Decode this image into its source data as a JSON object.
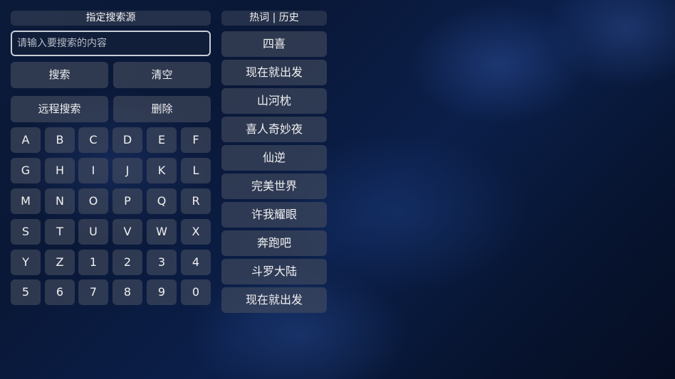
{
  "source_title": "指定搜索源",
  "history_title": "热词 | 历史",
  "search": {
    "placeholder": "请输入要搜索的内容",
    "value": ""
  },
  "buttons": {
    "search": "搜索",
    "clear": "清空",
    "remote_search": "远程搜索",
    "delete": "删除"
  },
  "keyboard": [
    [
      "A",
      "B",
      "C",
      "D",
      "E",
      "F"
    ],
    [
      "G",
      "H",
      "I",
      "J",
      "K",
      "L"
    ],
    [
      "M",
      "N",
      "O",
      "P",
      "Q",
      "R"
    ],
    [
      "S",
      "T",
      "U",
      "V",
      "W",
      "X"
    ],
    [
      "Y",
      "Z",
      "1",
      "2",
      "3",
      "4"
    ],
    [
      "5",
      "6",
      "7",
      "8",
      "9",
      "0"
    ]
  ],
  "hot_words": [
    "四喜",
    "现在就出发",
    "山河枕",
    "喜人奇妙夜",
    "仙逆",
    "完美世界",
    "许我耀眼",
    "奔跑吧",
    "斗罗大陆",
    "现在就出发"
  ]
}
